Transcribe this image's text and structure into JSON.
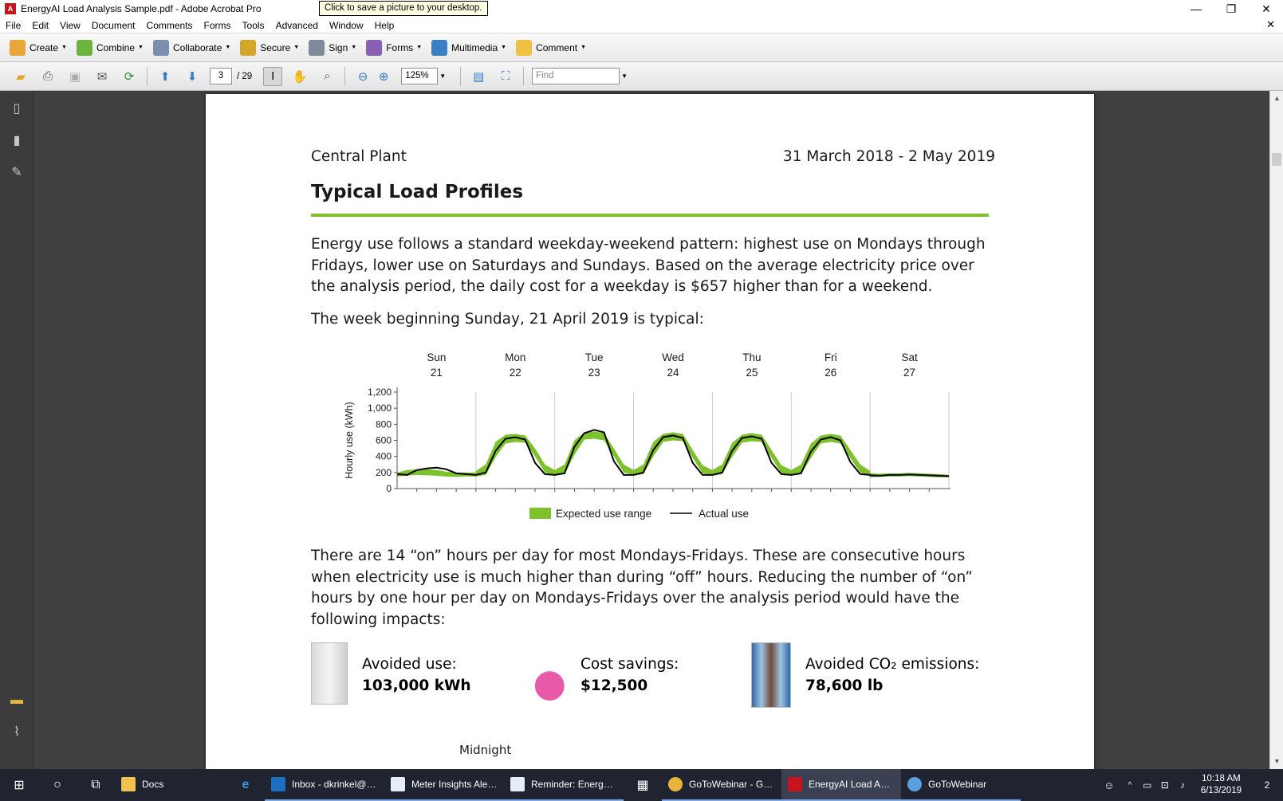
{
  "window": {
    "title": "EnergyAI Load Analysis Sample.pdf - Adobe Acrobat Pro",
    "tooltip": "Click to save a picture to your desktop.",
    "minimize": "—",
    "restore": "❐",
    "close": "✕"
  },
  "menu": {
    "items": [
      "File",
      "Edit",
      "View",
      "Document",
      "Comments",
      "Forms",
      "Tools",
      "Advanced",
      "Window",
      "Help"
    ],
    "doc_close": "✕"
  },
  "task_toolbar": {
    "create": "Create",
    "combine": "Combine",
    "collaborate": "Collaborate",
    "secure": "Secure",
    "sign": "Sign",
    "forms": "Forms",
    "multimedia": "Multimedia",
    "comment": "Comment"
  },
  "nav_toolbar": {
    "page_current": "3",
    "page_total": "/ 29",
    "zoom": "125%",
    "find_placeholder": "Find"
  },
  "document": {
    "plant": "Central Plant",
    "date_range": "31 March 2018 - 2 May 2019",
    "title": "Typical Load Profiles",
    "para1": "Energy use follows a standard weekday-weekend pattern: highest use on Mondays through Fridays, lower use on Saturdays and Sundays. Based on the average electricity price over the analysis period, the daily cost for a weekday is $657 higher than for a weekend.",
    "para2": "The week beginning Sunday, 21 April 2019 is typical:",
    "para3": "There are 14 “on” hours per day for most Mondays-Fridays. These are consecutive hours when electricity use is much higher than during “off” hours. Reducing the number of “on” hours by one hour per day on Mondays-Fridays over the analysis period would have the following impacts:",
    "impacts": [
      {
        "label": "Avoided use:",
        "value": "103,000 kWh"
      },
      {
        "label": "Cost savings:",
        "value": "$12,500"
      },
      {
        "label": "Avoided CO₂ emissions:",
        "value": "78,600 lb"
      }
    ],
    "midnight": "Midnight"
  },
  "chart_data": {
    "type": "area",
    "days": [
      {
        "day": "Sun",
        "date": "21"
      },
      {
        "day": "Mon",
        "date": "22"
      },
      {
        "day": "Tue",
        "date": "23"
      },
      {
        "day": "Wed",
        "date": "24"
      },
      {
        "day": "Thu",
        "date": "25"
      },
      {
        "day": "Fri",
        "date": "26"
      },
      {
        "day": "Sat",
        "date": "27"
      }
    ],
    "ylabel": "Hourly use (kWh)",
    "ylim": [
      0,
      1200
    ],
    "yticks": [
      0,
      200,
      400,
      600,
      800,
      1000,
      1200
    ],
    "ytick_labels": [
      "0",
      "200",
      "400",
      "600",
      "800",
      "1,000",
      "1,200"
    ],
    "series": [
      {
        "name": "Expected use range",
        "color": "#7dc22a"
      },
      {
        "name": "Actual use",
        "color": "#000000"
      }
    ],
    "profile_points_per_day": 9,
    "expected_low": [
      [
        150,
        160,
        170,
        165,
        160,
        150,
        145,
        150,
        150
      ],
      [
        150,
        170,
        390,
        560,
        580,
        570,
        400,
        200,
        160
      ],
      [
        160,
        180,
        420,
        610,
        620,
        600,
        400,
        200,
        170
      ],
      [
        160,
        180,
        400,
        580,
        600,
        590,
        380,
        190,
        160
      ],
      [
        160,
        180,
        390,
        570,
        590,
        580,
        380,
        190,
        160
      ],
      [
        160,
        180,
        380,
        560,
        580,
        560,
        380,
        200,
        160
      ],
      [
        140,
        145,
        150,
        150,
        155,
        150,
        145,
        140,
        140
      ]
    ],
    "expected_high": [
      [
        200,
        230,
        240,
        240,
        230,
        210,
        200,
        200,
        200
      ],
      [
        220,
        300,
        580,
        670,
        680,
        660,
        500,
        300,
        230
      ],
      [
        230,
        300,
        600,
        700,
        710,
        690,
        500,
        300,
        230
      ],
      [
        230,
        300,
        580,
        680,
        700,
        680,
        480,
        290,
        230
      ],
      [
        230,
        300,
        570,
        670,
        690,
        670,
        480,
        290,
        230
      ],
      [
        230,
        300,
        560,
        660,
        680,
        660,
        480,
        300,
        220
      ],
      [
        190,
        185,
        190,
        190,
        195,
        190,
        185,
        180,
        170
      ]
    ],
    "actual": [
      [
        180,
        170,
        230,
        250,
        260,
        240,
        190,
        180,
        170
      ],
      [
        170,
        200,
        470,
        620,
        640,
        610,
        320,
        180,
        170
      ],
      [
        170,
        190,
        520,
        690,
        730,
        700,
        340,
        170,
        170
      ],
      [
        170,
        200,
        480,
        640,
        660,
        630,
        320,
        170,
        170
      ],
      [
        170,
        200,
        470,
        630,
        650,
        620,
        320,
        180,
        170
      ],
      [
        170,
        190,
        460,
        610,
        640,
        600,
        330,
        180,
        170
      ],
      [
        165,
        160,
        170,
        170,
        175,
        170,
        165,
        160,
        155
      ]
    ]
  },
  "taskbar": {
    "apps": [
      {
        "label": "Docs",
        "color": "#f2c14e"
      },
      {
        "label": "Inbox - dkrinkel@e...",
        "color": "#1b70c4"
      },
      {
        "label": "Meter Insights Alert...",
        "color": "#e8eef7"
      },
      {
        "label": "Reminder: Energy ...",
        "color": "#e8eef7"
      },
      {
        "label": "GoToWebinar - Go...",
        "color": "#e8b53a"
      },
      {
        "label": "EnergyAI Load Anal...",
        "color": "#c8151d"
      },
      {
        "label": "GoToWebinar",
        "color": "#5a9fe0"
      }
    ],
    "time": "10:18 AM",
    "date": "6/13/2019",
    "notifications": "2"
  }
}
